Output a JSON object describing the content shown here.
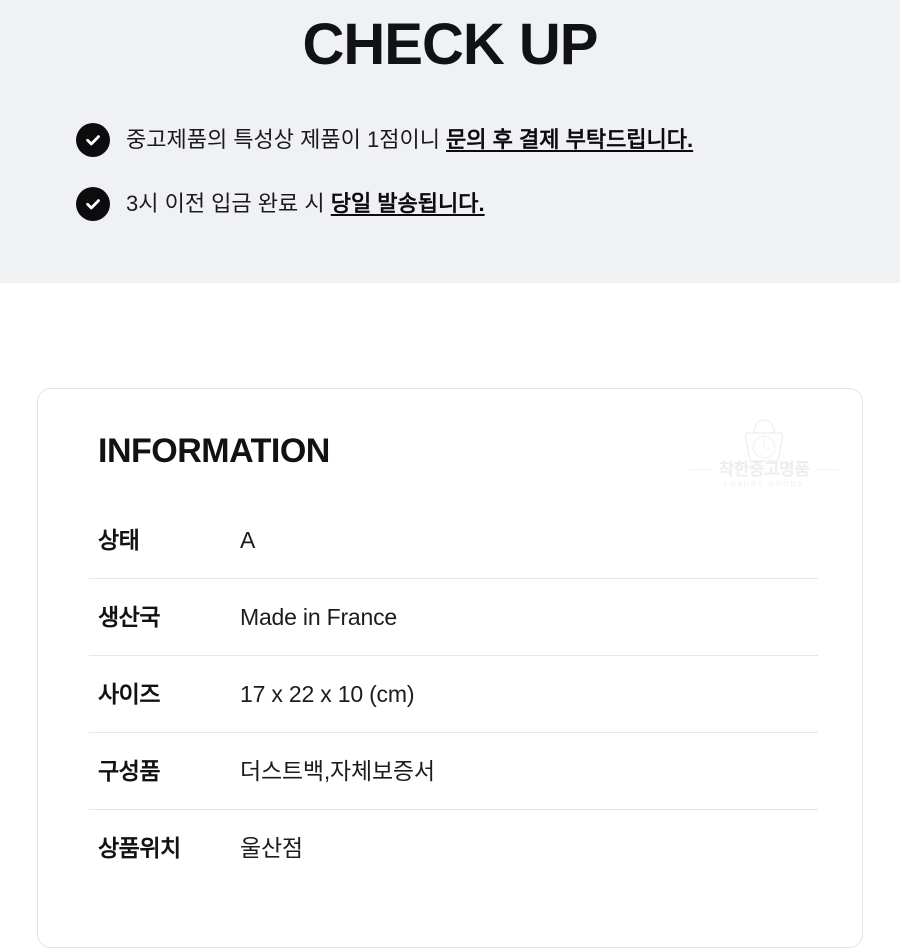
{
  "checkup": {
    "title": "CHECK UP",
    "band_color": "#f0f1f3",
    "items": [
      {
        "icon": "check-circle-icon",
        "text_plain": "중고제품의 특성상 제품이 1점이니 ",
        "text_emphasis": "문의 후 결제 부탁드립니다."
      },
      {
        "icon": "check-circle-icon",
        "text_plain": "3시 이전 입금 완료 시 ",
        "text_emphasis": "당일 발송됩니다."
      }
    ]
  },
  "information": {
    "title": "INFORMATION",
    "watermark": {
      "icon": "handbag-logo-icon",
      "name": "착한중고명품",
      "subtitle": "LUXURY GOODS",
      "color": "#eceded"
    },
    "rows": [
      {
        "label": "상태",
        "value": "A"
      },
      {
        "label": "생산국",
        "value": "Made in France"
      },
      {
        "label": "사이즈",
        "value": "17 x 22 x 10 (cm)"
      },
      {
        "label": "구성품",
        "value": "더스트백,자체보증서"
      },
      {
        "label": "상품위치",
        "value": "울산점"
      }
    ]
  },
  "colors": {
    "page_background": "#ffffff",
    "band_background": "#f0f1f3",
    "text_primary": "#111214",
    "divider": "#e6e7e9",
    "card_border": "#e3e4e6",
    "bullet_fill": "#0c0c0e"
  }
}
